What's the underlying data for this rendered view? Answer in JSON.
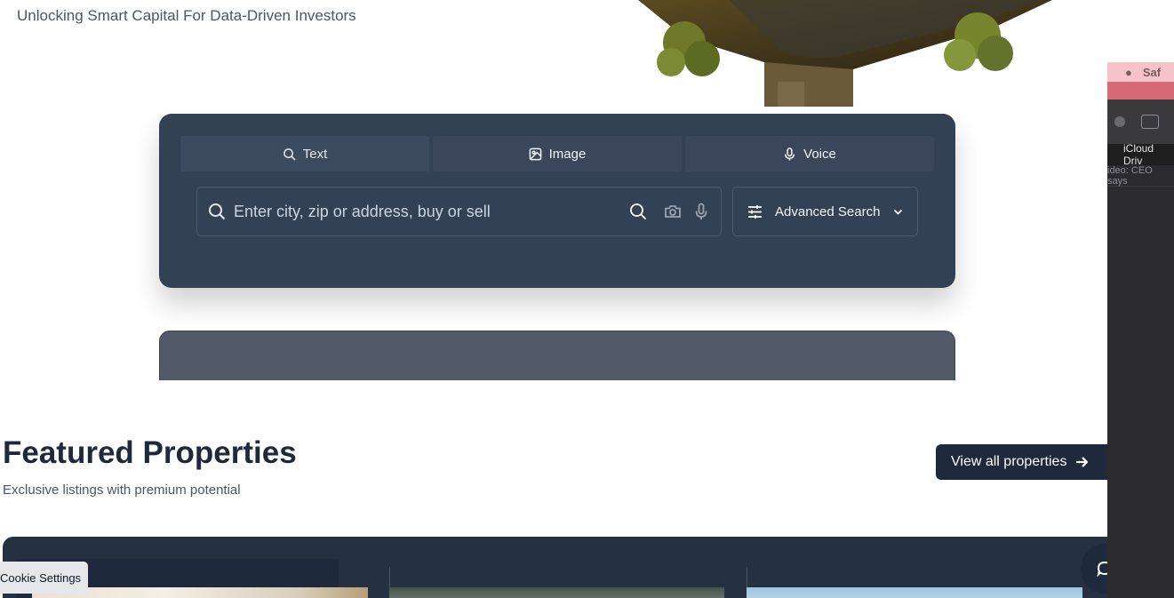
{
  "hero": {
    "tagline": "Unlocking Smart Capital For Data-Driven Investors"
  },
  "search": {
    "tabs": [
      {
        "label": "Text",
        "icon": "search-icon"
      },
      {
        "label": "Image",
        "icon": "image-icon"
      },
      {
        "label": "Voice",
        "icon": "microphone-icon"
      }
    ],
    "placeholder": "Enter city, zip or address, buy or sell",
    "value": "",
    "advanced_label": "Advanced Search"
  },
  "featured": {
    "title": "Featured Properties",
    "subtitle": "Exclusive listings with premium potential",
    "view_all_label": "View all properties"
  },
  "cookie": {
    "label": "Cookie Settings"
  },
  "side_window": {
    "app_menu": "Saf",
    "tab_label": "iCloud Driv",
    "video_label": "ideo: CEO says"
  },
  "colors": {
    "panel": "#334155",
    "dark": "#1e293b"
  }
}
